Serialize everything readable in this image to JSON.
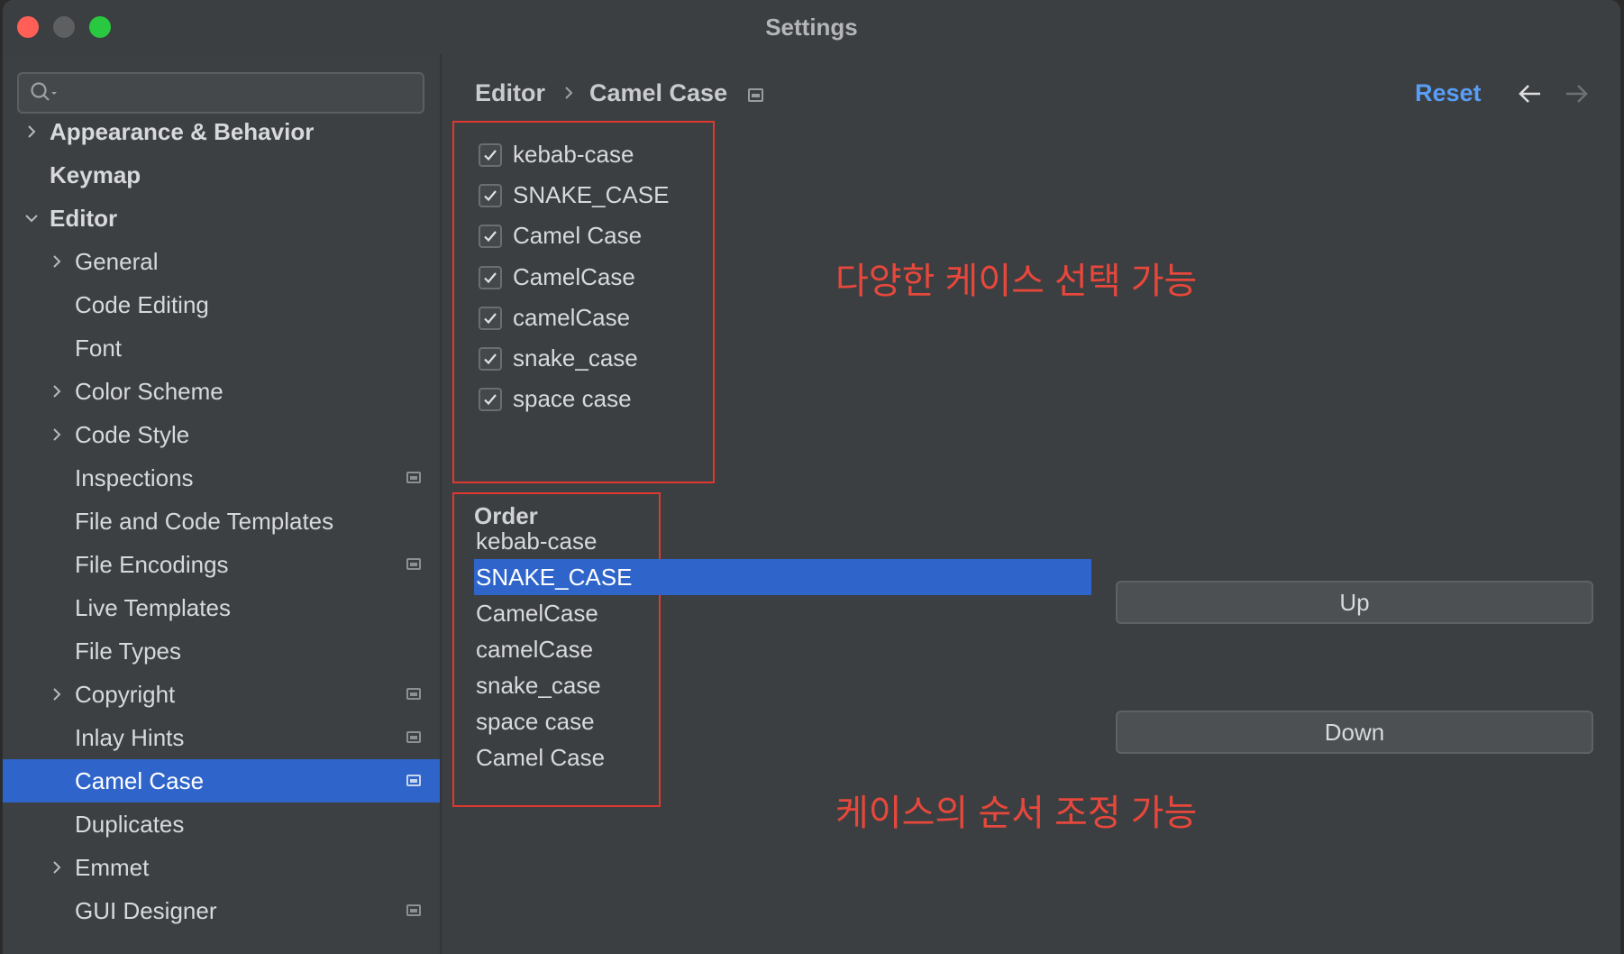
{
  "window": {
    "title": "Settings"
  },
  "search": {
    "placeholder": ""
  },
  "sidebar": {
    "items": [
      {
        "label": "Appearance & Behavior",
        "level": 0,
        "chevron": "right",
        "bold": true
      },
      {
        "label": "Keymap",
        "level": 0,
        "chevron": "none",
        "bold": true
      },
      {
        "label": "Editor",
        "level": 0,
        "chevron": "down",
        "bold": true
      },
      {
        "label": "General",
        "level": 1,
        "chevron": "right"
      },
      {
        "label": "Code Editing",
        "level": 1,
        "chevron": "none"
      },
      {
        "label": "Font",
        "level": 1,
        "chevron": "none"
      },
      {
        "label": "Color Scheme",
        "level": 1,
        "chevron": "right"
      },
      {
        "label": "Code Style",
        "level": 1,
        "chevron": "right"
      },
      {
        "label": "Inspections",
        "level": 1,
        "chevron": "none",
        "badge": true
      },
      {
        "label": "File and Code Templates",
        "level": 1,
        "chevron": "none"
      },
      {
        "label": "File Encodings",
        "level": 1,
        "chevron": "none",
        "badge": true
      },
      {
        "label": "Live Templates",
        "level": 1,
        "chevron": "none"
      },
      {
        "label": "File Types",
        "level": 1,
        "chevron": "none"
      },
      {
        "label": "Copyright",
        "level": 1,
        "chevron": "right",
        "badge": true
      },
      {
        "label": "Inlay Hints",
        "level": 1,
        "chevron": "none",
        "badge": true
      },
      {
        "label": "Camel Case",
        "level": 1,
        "chevron": "none",
        "badge": true,
        "selected": true
      },
      {
        "label": "Duplicates",
        "level": 1,
        "chevron": "none"
      },
      {
        "label": "Emmet",
        "level": 1,
        "chevron": "right"
      },
      {
        "label": "GUI Designer",
        "level": 1,
        "chevron": "none",
        "badge": true
      }
    ]
  },
  "breadcrumb": {
    "parent": "Editor",
    "current": "Camel Case"
  },
  "toolbar": {
    "reset_label": "Reset",
    "back_icon": "arrow-left-icon",
    "forward_icon": "arrow-right-icon"
  },
  "case_options": [
    {
      "label": "kebab-case",
      "checked": true
    },
    {
      "label": "SNAKE_CASE",
      "checked": true
    },
    {
      "label": "Camel Case",
      "checked": true
    },
    {
      "label": "CamelCase",
      "checked": true
    },
    {
      "label": "camelCase",
      "checked": true
    },
    {
      "label": "snake_case",
      "checked": true
    },
    {
      "label": "space case",
      "checked": true
    }
  ],
  "order": {
    "title": "Order",
    "items": [
      "kebab-case",
      "SNAKE_CASE",
      "CamelCase",
      "camelCase",
      "snake_case",
      "space case",
      "Camel Case"
    ],
    "selected_index": 1
  },
  "buttons": {
    "up_label": "Up",
    "down_label": "Down"
  },
  "annotations": {
    "options_note": "다양한 케이스 선택 가능",
    "order_note": "케이스의 순서 조정 가능",
    "color": "#e8473b"
  },
  "colors": {
    "accent": "#2f65ca",
    "link": "#589df6",
    "highlight_box": "#e0382e"
  }
}
